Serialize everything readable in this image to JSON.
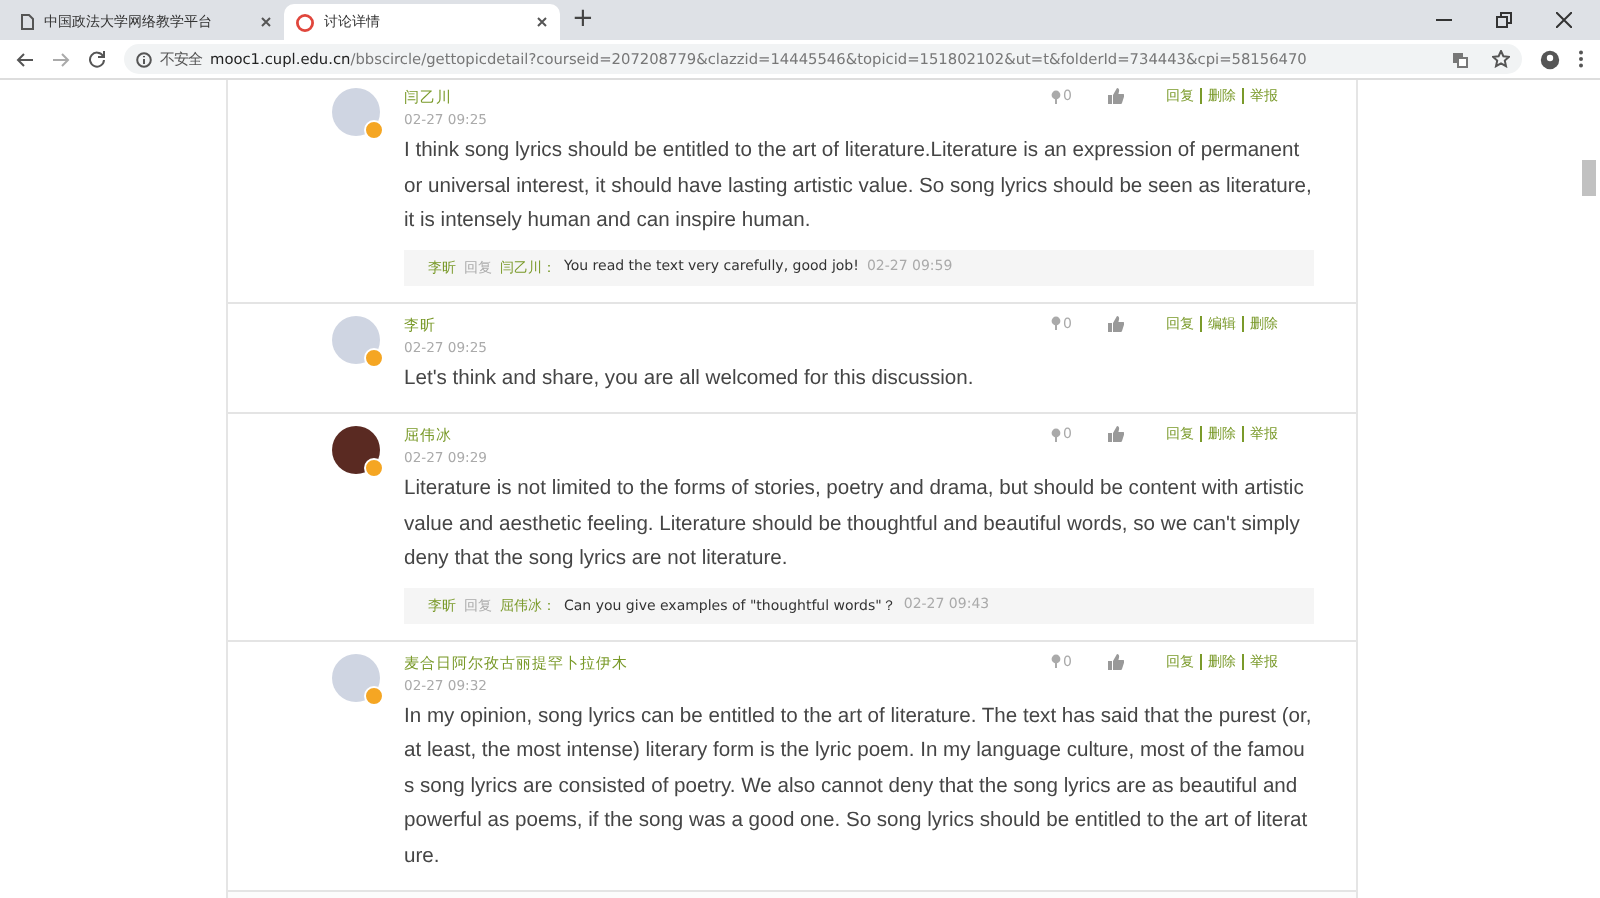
{
  "browser": {
    "tabs": [
      {
        "title": "中国政法大学网络教学平台",
        "selected": false,
        "kind": "doc"
      },
      {
        "title": "讨论详情",
        "selected": true,
        "kind": "site"
      }
    ],
    "new_tab": "+",
    "address": {
      "security": "不安全",
      "host": "mooc1.cupl.edu.cn",
      "path": "/bbscircle/gettopicdetail?courseid=207208779&clazzid=14445546&topicid=151802102&ut=t&folderId=734443&cpi=58156470"
    }
  },
  "posts": [
    {
      "author": "闫乙川",
      "time": "02-27 09:25",
      "avatar": {
        "kind": "default"
      },
      "count": "0",
      "actions": [
        "回复",
        "删除",
        "举报"
      ],
      "text": "I think song lyrics should be entitled to the art of literature.Literature is an expression of permanent or universal interest, it should have lasting artistic value. So song lyrics should be seen as literature, it is intensely human and can inspire human.",
      "replies": [
        {
          "author": "李昕",
          "verb": "回复",
          "target": "闫乙川：",
          "text": "You read the text very carefully, good job!",
          "time": "02-27 09:59"
        }
      ]
    },
    {
      "author": "李昕",
      "time": "02-27 09:25",
      "avatar": {
        "kind": "default"
      },
      "count": "0",
      "actions": [
        "回复",
        "编辑",
        "删除"
      ],
      "text": "Let's think and share, you are all welcomed for this discussion."
    },
    {
      "author": "屈伟冰",
      "time": "02-27 09:29",
      "avatar": {
        "kind": "photo"
      },
      "count": "0",
      "actions": [
        "回复",
        "删除",
        "举报"
      ],
      "text": "Literature is not limited to the forms of stories, poetry and drama, but should be content with artistic value and aesthetic feeling. Literature should be thoughtful and beautiful words, so we can't simply deny that the song lyrics are not literature.",
      "replies": [
        {
          "author": "李昕",
          "verb": "回复",
          "target": "屈伟冰：",
          "text": "Can you give examples of \"thoughtful words\"？",
          "time": "02-27 09:43"
        }
      ]
    },
    {
      "author": "麦合日阿尔孜古丽提罕卜拉伊木",
      "time": "02-27 09:32",
      "avatar": {
        "kind": "default"
      },
      "count": "0",
      "actions": [
        "回复",
        "删除",
        "举报"
      ],
      "text": "In my opinion, song lyrics can be entitled to the art of literature. The text has said that the purest (or, at least, the most intense) literary form is the lyric poem. In my language culture, most of the famous song lyrics are consisted of poetry. We also cannot deny that the song lyrics are as beautiful and powerful as poems, if the song was a good one. So song lyrics should be entitled to the art of literature."
    }
  ]
}
